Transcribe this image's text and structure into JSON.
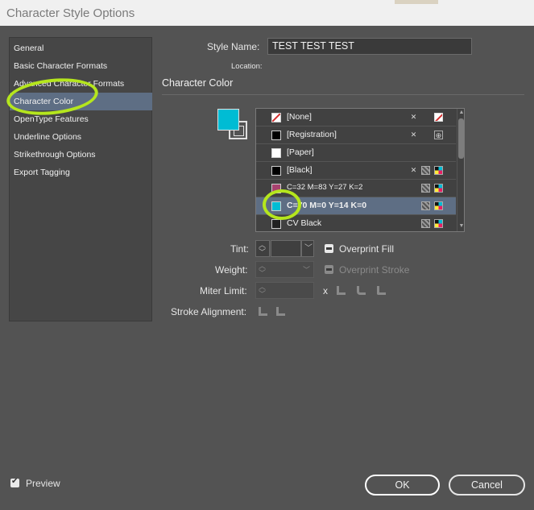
{
  "window": {
    "title": "Character Style Options"
  },
  "sidebar": {
    "items": [
      {
        "label": "General"
      },
      {
        "label": "Basic Character Formats"
      },
      {
        "label": "Advanced Character Formats"
      },
      {
        "label": "Character Color"
      },
      {
        "label": "OpenType Features"
      },
      {
        "label": "Underline Options"
      },
      {
        "label": "Strikethrough Options"
      },
      {
        "label": "Export Tagging"
      }
    ],
    "selected": "Character Color"
  },
  "header": {
    "style_name_label": "Style Name:",
    "style_name_value": "TEST TEST TEST",
    "location_label": "Location:"
  },
  "section": {
    "title": "Character Color"
  },
  "colors": {
    "fill": "#00bcd4",
    "selection": "#5e6e84",
    "annotation": "#b5e61d"
  },
  "swatches": [
    {
      "name": "[None]",
      "chip": "none"
    },
    {
      "name": "[Registration]",
      "chip": "#000000"
    },
    {
      "name": "[Paper]",
      "chip": "#ffffff"
    },
    {
      "name": "[Black]",
      "chip": "#000000"
    },
    {
      "name": "C=32 M=83 Y=27 K=2",
      "chip": "#a8426f"
    },
    {
      "name": "C=70 M=0 Y=14 K=0",
      "chip": "#00bcd4",
      "selected": true
    },
    {
      "name": "CV Black",
      "chip": "#222222"
    }
  ],
  "controls": {
    "tint_label": "Tint:",
    "weight_label": "Weight:",
    "miter_label": "Miter Limit:",
    "miter_unit": "x",
    "stroke_align_label": "Stroke Alignment:",
    "overprint_fill": "Overprint Fill",
    "overprint_stroke": "Overprint Stroke"
  },
  "footer": {
    "preview_label": "Preview",
    "ok_label": "OK",
    "cancel_label": "Cancel"
  }
}
